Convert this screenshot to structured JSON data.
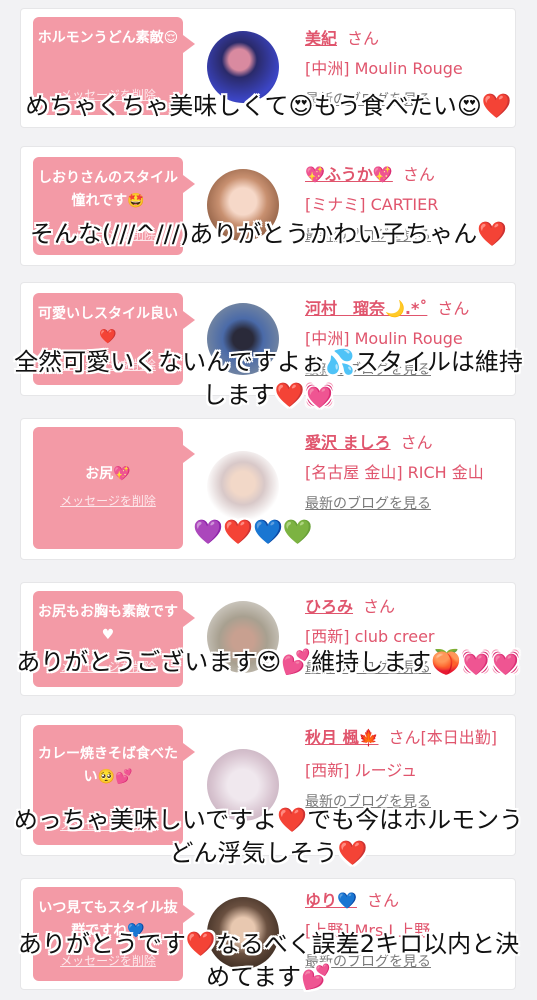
{
  "san_label": "さん",
  "delete_label": "メッセージを削除",
  "blog_label": "最新のブログを見る",
  "entries": [
    {
      "message": "ホルモンうどん素敵😌",
      "name": "美紀",
      "shop": "[中洲] Moulin Rouge",
      "caption": "めちゃくちゃ美味しくて😍もう食べたい😍❤️"
    },
    {
      "message": "しおりさんのスタイル憧れです🤩",
      "name": "💖ふうか💖",
      "shop": "[ミナミ] CARTIER",
      "caption": "そんな(///^///)ありがとうかわい子ちゃん❤️"
    },
    {
      "message": "可愛いしスタイル良い❤️",
      "name": "河村　瑠奈🌙.*˚",
      "shop": "[中洲] Moulin Rouge",
      "caption": "全然可愛いくないんですよぉ💦スタイルは維持します❤️💓"
    },
    {
      "message": "お尻💖",
      "name": "愛沢 ましろ",
      "shop": "[名古屋 金山] RICH 金山",
      "caption": "💜❤️💙💚"
    },
    {
      "message": "お尻もお胸も素敵です♥",
      "name": "ひろみ",
      "shop": "[西新] club creer",
      "caption": "ありがとうございます😍💕維持します🍑💓💓"
    },
    {
      "message": "カレー焼きそば食べたい🥺💕",
      "name": "秋月 楓🍁",
      "san_suffix": "[本日出勤]",
      "shop": "[西新] ルージュ",
      "caption": "めっちゃ美味しいですよ❤️でも今はホルモンうどん浮気しそう❤️"
    },
    {
      "message": "いつ見てもスタイル抜群ですね💙",
      "name": "ゆり💙",
      "shop": "[上野] Mrs.J 上野",
      "caption": "ありがとうです❤️なるべく誤差2キロ以内と決めてます💕"
    }
  ],
  "colors": {
    "accent": "#e0556d",
    "bubble": "#f39aa6",
    "background": "#f2f2f4"
  }
}
